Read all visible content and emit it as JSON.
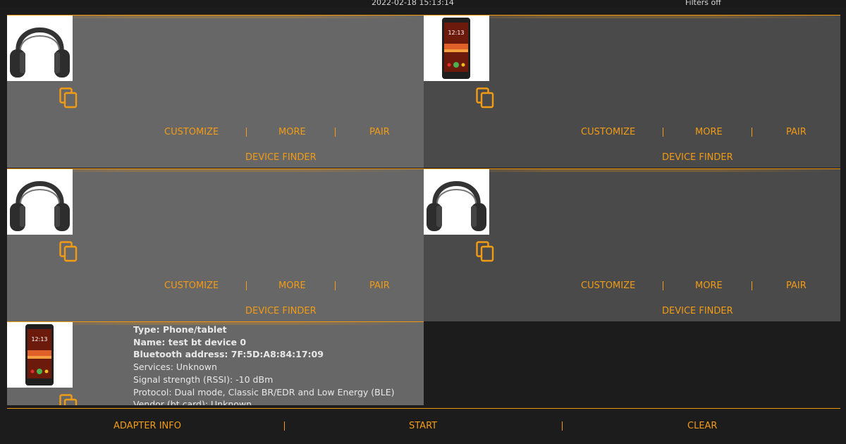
{
  "status": {
    "datetime": "2022-02-18 15:13:14",
    "filters": "Filters off"
  },
  "labels": {
    "customize": "CUSTOMIZE",
    "more": "MORE",
    "pair": "PAIR",
    "finder": "DEVICE FINDER"
  },
  "colors": {
    "accent": "#f29b15",
    "card_gray": "#676767",
    "card_dark": "#4a4a4a",
    "background": "#1c1c1c"
  },
  "cards": [
    {
      "icon": "headphones-icon"
    },
    {
      "icon": "phone-icon",
      "phone_time": "12:13"
    },
    {
      "icon": "headphones-icon"
    },
    {
      "icon": "headphones-icon"
    }
  ],
  "detail_card": {
    "icon": "phone-icon",
    "phone_time": "12:13",
    "lines": [
      "Type: Phone/tablet",
      "Name: test bt device 0",
      "Bluetooth address: 7F:5D:A8:84:17:09",
      "Services: Unknown",
      "Signal strength (RSSI): -10 dBm",
      "Protocol: Dual mode, Classic BR/EDR and Low Energy (BLE)",
      "Vendor (bt card): Unknown"
    ]
  },
  "bottom": {
    "adapter_info": "ADAPTER INFO",
    "start": "START",
    "clear": "CLEAR"
  }
}
